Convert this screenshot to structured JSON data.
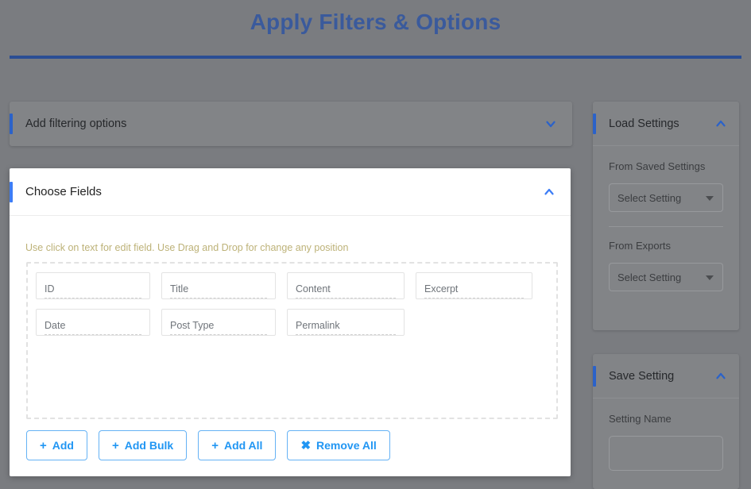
{
  "header": {
    "title": "Apply Filters & Options"
  },
  "filter_panel": {
    "title": "Add filtering options",
    "toggle_icon": "chevron-down-icon",
    "expanded": false
  },
  "fields_panel": {
    "title": "Choose Fields",
    "toggle_icon": "chevron-up-icon",
    "expanded": true,
    "hint": "Use click on text for edit field. Use Drag and Drop for change any position",
    "chips": [
      {
        "label": "ID"
      },
      {
        "label": "Title"
      },
      {
        "label": "Content"
      },
      {
        "label": "Excerpt"
      },
      {
        "label": "Date"
      },
      {
        "label": "Post Type"
      },
      {
        "label": "Permalink"
      }
    ],
    "buttons": [
      {
        "icon": "plus-icon",
        "glyph": "+",
        "label": "Add"
      },
      {
        "icon": "plus-icon",
        "glyph": "+",
        "label": "Add Bulk"
      },
      {
        "icon": "plus-icon",
        "glyph": "+",
        "label": "Add All"
      },
      {
        "icon": "close-icon",
        "glyph": "✖",
        "label": "Remove All"
      }
    ]
  },
  "sidebar": {
    "load_settings": {
      "title": "Load Settings",
      "toggle_icon": "chevron-up-icon",
      "saved_label": "From Saved Settings",
      "saved_select_value": "Select Setting",
      "exports_label": "From Exports",
      "exports_select_value": "Select Setting"
    },
    "save_setting": {
      "title": "Save Setting",
      "toggle_icon": "chevron-up-icon",
      "name_label": "Setting Name",
      "name_value": "",
      "name_placeholder": ""
    }
  },
  "colors": {
    "title_blue": "#3a5a9c",
    "rule_blue": "#2b4e94",
    "accent_blue": "#2b62c9",
    "bright_blue": "#3d7df6",
    "button_blue": "#2196f3",
    "hint_khaki": "#bdb278",
    "overlay_gray": "#7a7c80",
    "card_gray": "#828487"
  }
}
